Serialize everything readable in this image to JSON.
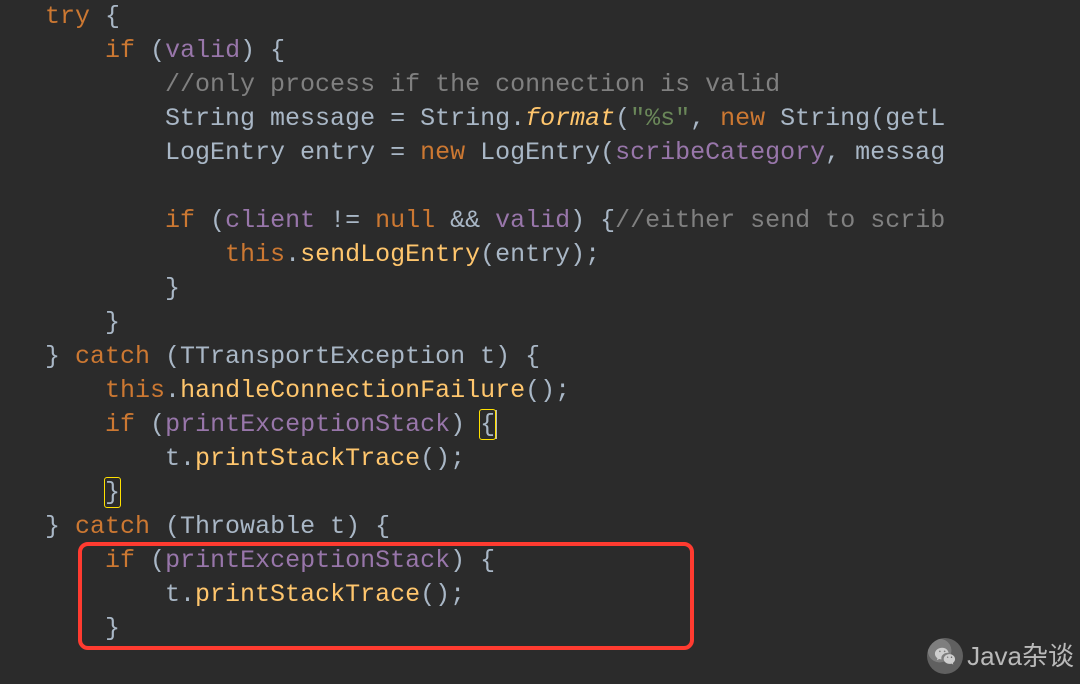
{
  "colors": {
    "bg": "#2b2b2b",
    "text": "#a9b7c6",
    "keyword": "#cc7832",
    "variable": "#9876aa",
    "string": "#6a8759",
    "comment": "#808080",
    "method": "#ffc66d",
    "highlight_border": "#ff3b30"
  },
  "watermark": {
    "label": "Java杂谈"
  },
  "code": {
    "lines": [
      {
        "indent": "   ",
        "tokens": [
          {
            "t": "try",
            "c": "kw"
          },
          {
            "t": " {",
            "c": "pun"
          }
        ]
      },
      {
        "indent": "       ",
        "tokens": [
          {
            "t": "if",
            "c": "kw"
          },
          {
            "t": " (",
            "c": "pun"
          },
          {
            "t": "valid",
            "c": "var"
          },
          {
            "t": ") {",
            "c": "pun"
          }
        ]
      },
      {
        "indent": "           ",
        "tokens": [
          {
            "t": "//only process if the connection is valid",
            "c": "cmt"
          }
        ]
      },
      {
        "indent": "           ",
        "tokens": [
          {
            "t": "String message = String.",
            "c": "type"
          },
          {
            "t": "format",
            "c": "smeth"
          },
          {
            "t": "(",
            "c": "pun"
          },
          {
            "t": "\"%s\"",
            "c": "str"
          },
          {
            "t": ", ",
            "c": "pun"
          },
          {
            "t": "new",
            "c": "kw"
          },
          {
            "t": " String(getL",
            "c": "type"
          }
        ]
      },
      {
        "indent": "           ",
        "tokens": [
          {
            "t": "LogEntry entry = ",
            "c": "type"
          },
          {
            "t": "new",
            "c": "kw"
          },
          {
            "t": " LogEntry(",
            "c": "type"
          },
          {
            "t": "scribeCategory",
            "c": "var"
          },
          {
            "t": ", messag",
            "c": "type"
          }
        ]
      },
      {
        "indent": "",
        "tokens": [
          {
            "t": "",
            "c": "pun"
          }
        ]
      },
      {
        "indent": "           ",
        "tokens": [
          {
            "t": "if",
            "c": "kw"
          },
          {
            "t": " (",
            "c": "pun"
          },
          {
            "t": "client",
            "c": "var"
          },
          {
            "t": " != ",
            "c": "pun"
          },
          {
            "t": "null",
            "c": "kw"
          },
          {
            "t": " && ",
            "c": "pun"
          },
          {
            "t": "valid",
            "c": "var"
          },
          {
            "t": ") {",
            "c": "pun"
          },
          {
            "t": "//either send to scrib",
            "c": "cmt"
          }
        ]
      },
      {
        "indent": "               ",
        "tokens": [
          {
            "t": "this",
            "c": "kw"
          },
          {
            "t": ".",
            "c": "pun"
          },
          {
            "t": "sendLogEntry",
            "c": "meth"
          },
          {
            "t": "(entry);",
            "c": "pun"
          }
        ]
      },
      {
        "indent": "           ",
        "tokens": [
          {
            "t": "}",
            "c": "pun"
          }
        ]
      },
      {
        "indent": "       ",
        "tokens": [
          {
            "t": "}",
            "c": "pun"
          }
        ]
      },
      {
        "indent": "   ",
        "tokens": [
          {
            "t": "} ",
            "c": "pun"
          },
          {
            "t": "catch",
            "c": "kw"
          },
          {
            "t": " (TTransportException t) {",
            "c": "pun"
          }
        ]
      },
      {
        "indent": "       ",
        "tokens": [
          {
            "t": "this",
            "c": "kw"
          },
          {
            "t": ".",
            "c": "pun"
          },
          {
            "t": "handleConnectionFailure",
            "c": "meth"
          },
          {
            "t": "();",
            "c": "pun"
          }
        ]
      },
      {
        "indent": "       ",
        "tokens": [
          {
            "t": "if",
            "c": "kw"
          },
          {
            "t": " (",
            "c": "pun"
          },
          {
            "t": "printExceptionStack",
            "c": "var"
          },
          {
            "t": ") ",
            "c": "pun"
          },
          {
            "t": "{",
            "c": "pun",
            "mark": "open"
          },
          {
            "t": "",
            "c": "pun",
            "mark": "caret"
          }
        ]
      },
      {
        "indent": "           ",
        "tokens": [
          {
            "t": "t.",
            "c": "type"
          },
          {
            "t": "printStackTrace",
            "c": "meth"
          },
          {
            "t": "();",
            "c": "pun"
          }
        ]
      },
      {
        "indent": "       ",
        "tokens": [
          {
            "t": "}",
            "c": "pun",
            "mark": "close"
          }
        ]
      },
      {
        "indent": "   ",
        "tokens": [
          {
            "t": "} ",
            "c": "pun"
          },
          {
            "t": "catch",
            "c": "kw"
          },
          {
            "t": " (Throwable t) {",
            "c": "pun"
          }
        ]
      },
      {
        "indent": "       ",
        "tokens": [
          {
            "t": "if",
            "c": "kw"
          },
          {
            "t": " (",
            "c": "pun"
          },
          {
            "t": "printExceptionStack",
            "c": "var"
          },
          {
            "t": ") {",
            "c": "pun"
          }
        ]
      },
      {
        "indent": "           ",
        "tokens": [
          {
            "t": "t.",
            "c": "type"
          },
          {
            "t": "printStackTrace",
            "c": "meth"
          },
          {
            "t": "();",
            "c": "pun"
          }
        ]
      },
      {
        "indent": "       ",
        "tokens": [
          {
            "t": "}",
            "c": "pun"
          }
        ]
      }
    ],
    "highlight_line_index": 12,
    "red_box": {
      "top_line": 16,
      "height_lines": 3
    }
  }
}
